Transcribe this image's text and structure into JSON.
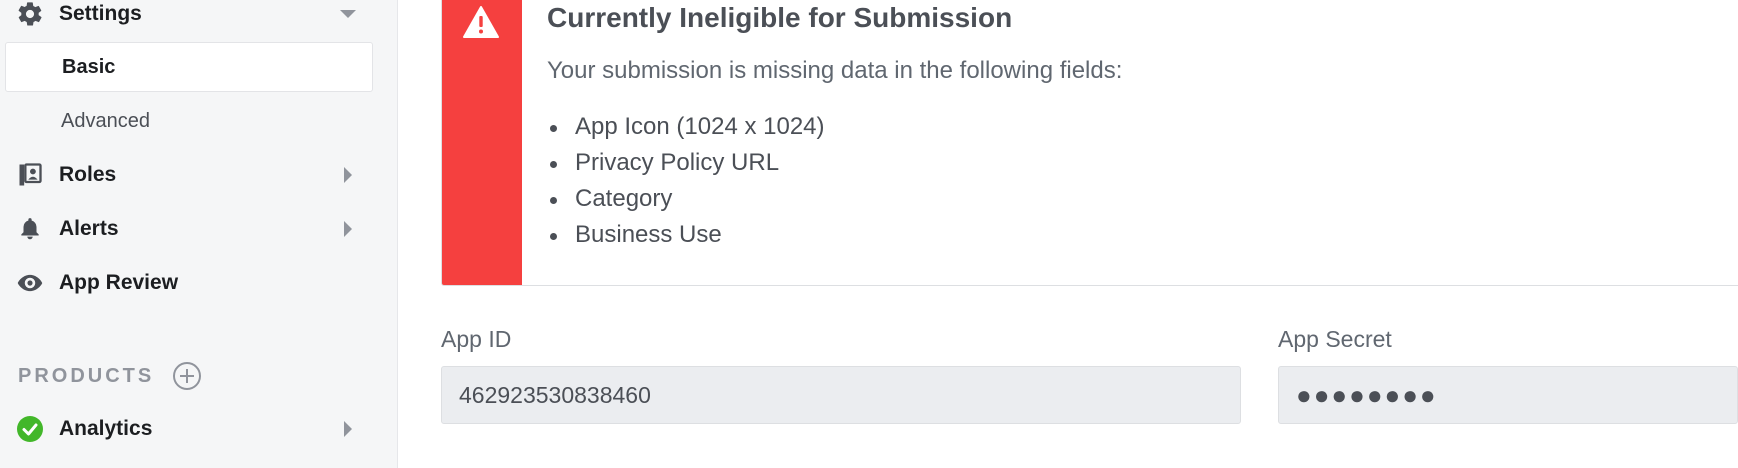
{
  "sidebar": {
    "settings": {
      "label": "Settings",
      "icon": "gear-icon"
    },
    "sub_items": [
      {
        "label": "Basic",
        "active": true
      },
      {
        "label": "Advanced",
        "active": false
      }
    ],
    "items": [
      {
        "label": "Roles",
        "icon": "roles-icon"
      },
      {
        "label": "Alerts",
        "icon": "bell-icon"
      },
      {
        "label": "App Review",
        "icon": "eye-icon"
      }
    ],
    "products_header": "PRODUCTS",
    "products": [
      {
        "label": "Analytics",
        "icon": "check-circle-icon",
        "icon_color": "#42b72a"
      }
    ]
  },
  "alert": {
    "title": "Currently Ineligible for Submission",
    "description": "Your submission is missing data in the following fields:",
    "missing_fields": [
      "App Icon (1024 x 1024)",
      "Privacy Policy URL",
      "Category",
      "Business Use"
    ],
    "accent_color": "#f5403f",
    "icon": "warning-icon"
  },
  "fields": {
    "app_id": {
      "label": "App ID",
      "value": "462923530838460"
    },
    "app_secret": {
      "label": "App Secret",
      "value": "●●●●●●●●"
    }
  }
}
